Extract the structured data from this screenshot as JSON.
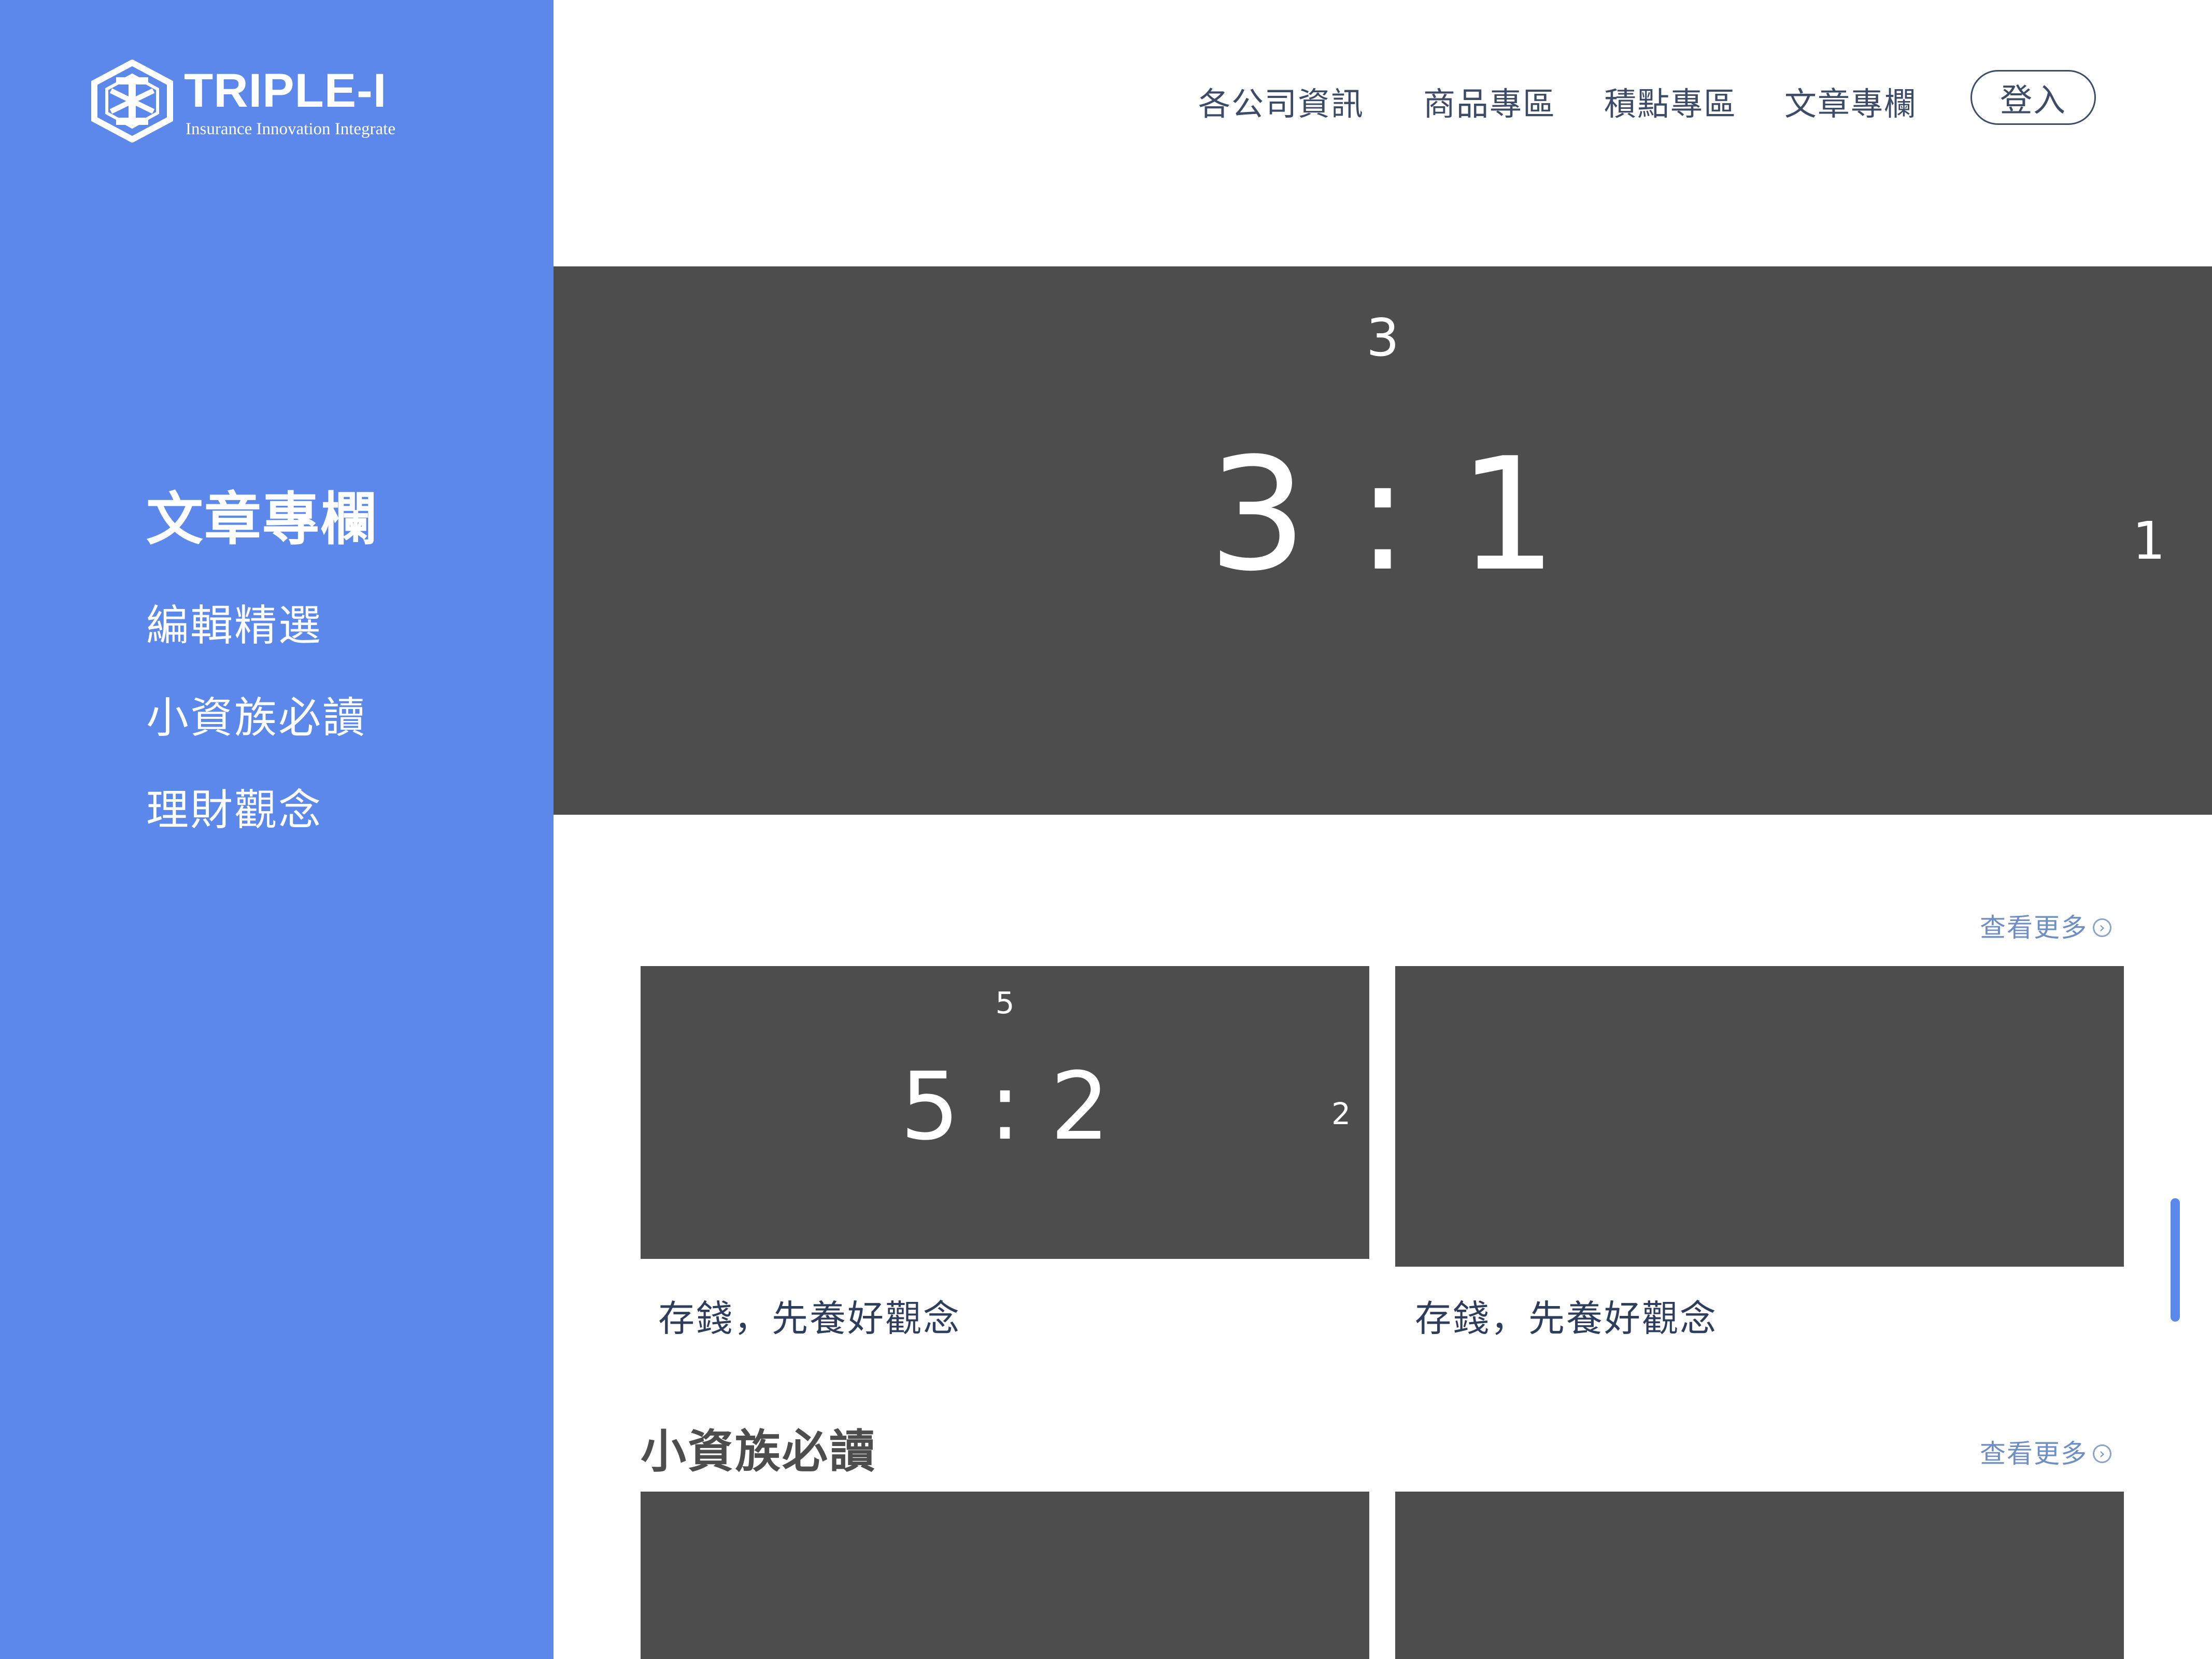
{
  "brand": {
    "name": "TRIPLE-I",
    "tagline": "Insurance Innovation Integrate",
    "accent_color": "#5b88ea",
    "logo_icon": "triple-i-hexagon-logo"
  },
  "nav": {
    "links": [
      "各公司資訊",
      "商品專區",
      "積點專區",
      "文章專欄"
    ],
    "login_label": "登入"
  },
  "sidebar": {
    "title": "文章專欄",
    "items": [
      "編輯精選",
      "小資族必讀",
      "理財觀念"
    ]
  },
  "hero": {
    "placeholder_ratio": "3 : 1",
    "top_label": "3",
    "side_label": "1"
  },
  "featured": {
    "more_label": "查看更多",
    "cards": [
      {
        "caption": "存錢，先養好觀念",
        "placeholder_ratio": "5 : 2",
        "top_label": "5",
        "side_label": "2"
      },
      {
        "caption": "存錢，先養好觀念"
      }
    ]
  },
  "young_saver": {
    "title": "小資族必讀",
    "more_label": "查看更多"
  }
}
